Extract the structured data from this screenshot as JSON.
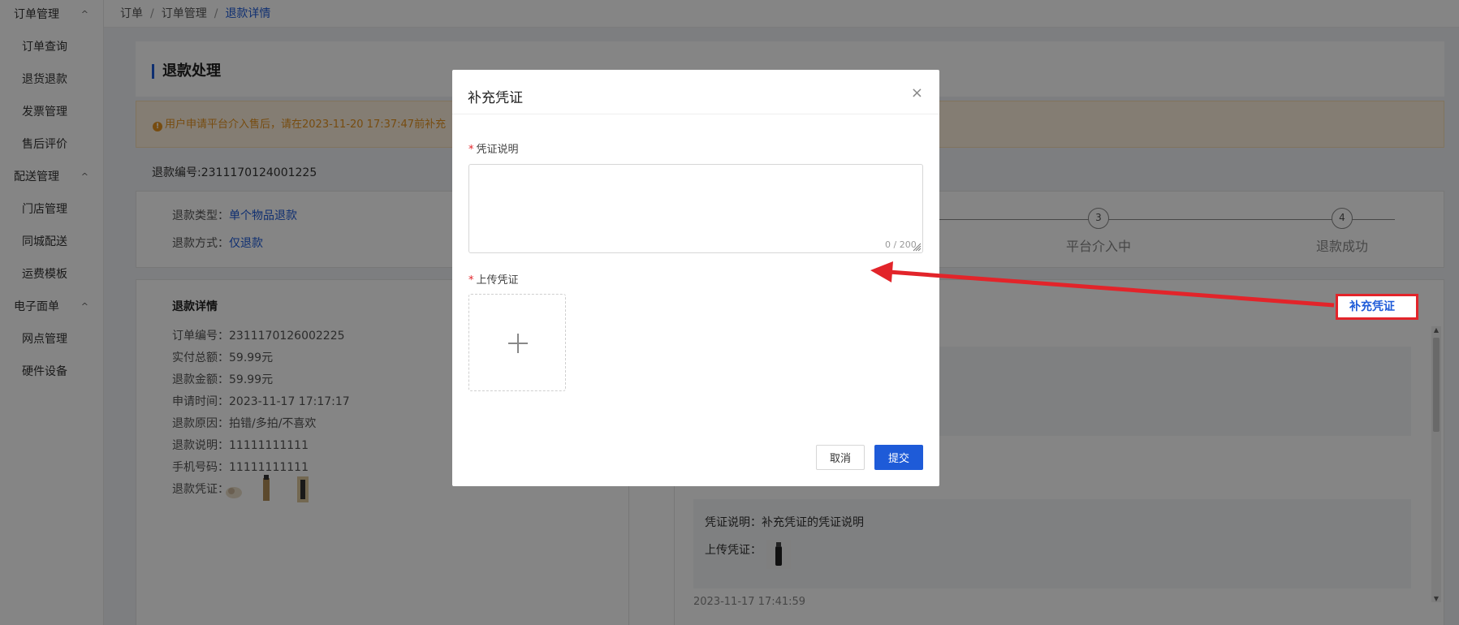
{
  "sidebar": {
    "groups": [
      {
        "label": "订单管理",
        "items": [
          "订单查询",
          "退货退款",
          "发票管理",
          "售后评价"
        ]
      },
      {
        "label": "配送管理",
        "items": [
          "门店管理",
          "同城配送",
          "运费模板"
        ]
      },
      {
        "label": "电子面单",
        "items": [
          "网点管理",
          "硬件设备"
        ]
      }
    ]
  },
  "breadcrumb": {
    "items": [
      "订单",
      "订单管理"
    ],
    "current": "退款详情",
    "separator": "/"
  },
  "page": {
    "title": "退款处理"
  },
  "notice": {
    "text": "用户申请平台介入售后，请在2023-11-20 17:37:47前补充"
  },
  "refund": {
    "number_label": "退款编号:2311170124001225",
    "type_label": "退款类型：",
    "type_value": "单个物品退款",
    "method_label": "退款方式：",
    "method_value": "仅退款"
  },
  "steps": [
    {
      "num": "3",
      "label": "平台介入中"
    },
    {
      "num": "4",
      "label": "退款成功"
    }
  ],
  "detail": {
    "heading": "退款详情",
    "lines": [
      "订单编号：2311170126002225",
      "实付总额：59.99元",
      "退款金额：59.99元",
      "申请时间：2023-11-17 17:17:17",
      "退款原因：拍错/多拍/不喜欢",
      "退款说明：11111111111",
      "手机号码：11111111111",
      "退款凭证："
    ]
  },
  "supplement_button": {
    "label": "补充凭证"
  },
  "history": {
    "desc": "凭证说明：补充凭证的凭证说明",
    "upload": "上传凭证：",
    "time": "2023-11-17 17:41:59"
  },
  "modal": {
    "title": "补充凭证",
    "close": "×",
    "desc_label": "凭证说明",
    "desc_value": "",
    "counter": "0 / 200",
    "upload_label": "上传凭证",
    "cancel": "取消",
    "submit": "提交"
  },
  "colors": {
    "primary": "#1e5bd8",
    "danger": "#e2242a",
    "warning": "#e59320"
  }
}
